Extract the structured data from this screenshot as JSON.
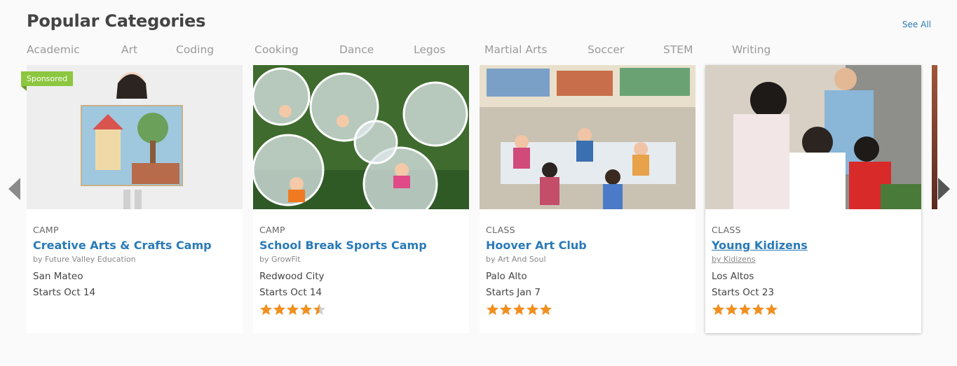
{
  "header": {
    "title": "Popular Categories",
    "see_all": "See All"
  },
  "tabs": [
    "Academic",
    "Art",
    "Coding",
    "Cooking",
    "Dance",
    "Legos",
    "Martial Arts",
    "Soccer",
    "STEM",
    "Writing"
  ],
  "sponsored_label": "Sponsored",
  "carousel": {
    "prev_icon": "chevron-left-icon",
    "next_icon": "chevron-right-icon"
  },
  "cards": [
    {
      "type": "CAMP",
      "title": "Creative Arts & Crafts Camp",
      "provider": "by Future Valley Education",
      "location": "San Mateo",
      "starts": "Starts Oct 14",
      "rating": null,
      "image": "girl holding painting"
    },
    {
      "type": "CAMP",
      "title": "School Break Sports Camp",
      "provider": "by GrowFit",
      "location": "Redwood City",
      "starts": "Starts Oct 14",
      "rating": 4.5,
      "image": "kids in bubble balls"
    },
    {
      "type": "CLASS",
      "title": "Hoover Art Club",
      "provider": "by Art And Soul",
      "location": "Palo Alto",
      "starts": "Starts Jan 7",
      "rating": 5,
      "image": "art classroom"
    },
    {
      "type": "CLASS",
      "title": "Young Kidizens",
      "provider": "by Kidizens",
      "location": "Los Altos",
      "starts": "Starts Oct 23",
      "rating": 5,
      "image": "kids with teacher"
    }
  ],
  "colors": {
    "link": "#2a7ab8",
    "star": "#f28f1e",
    "star_empty": "#cfcfcf",
    "sponsored": "#8dc63f"
  }
}
